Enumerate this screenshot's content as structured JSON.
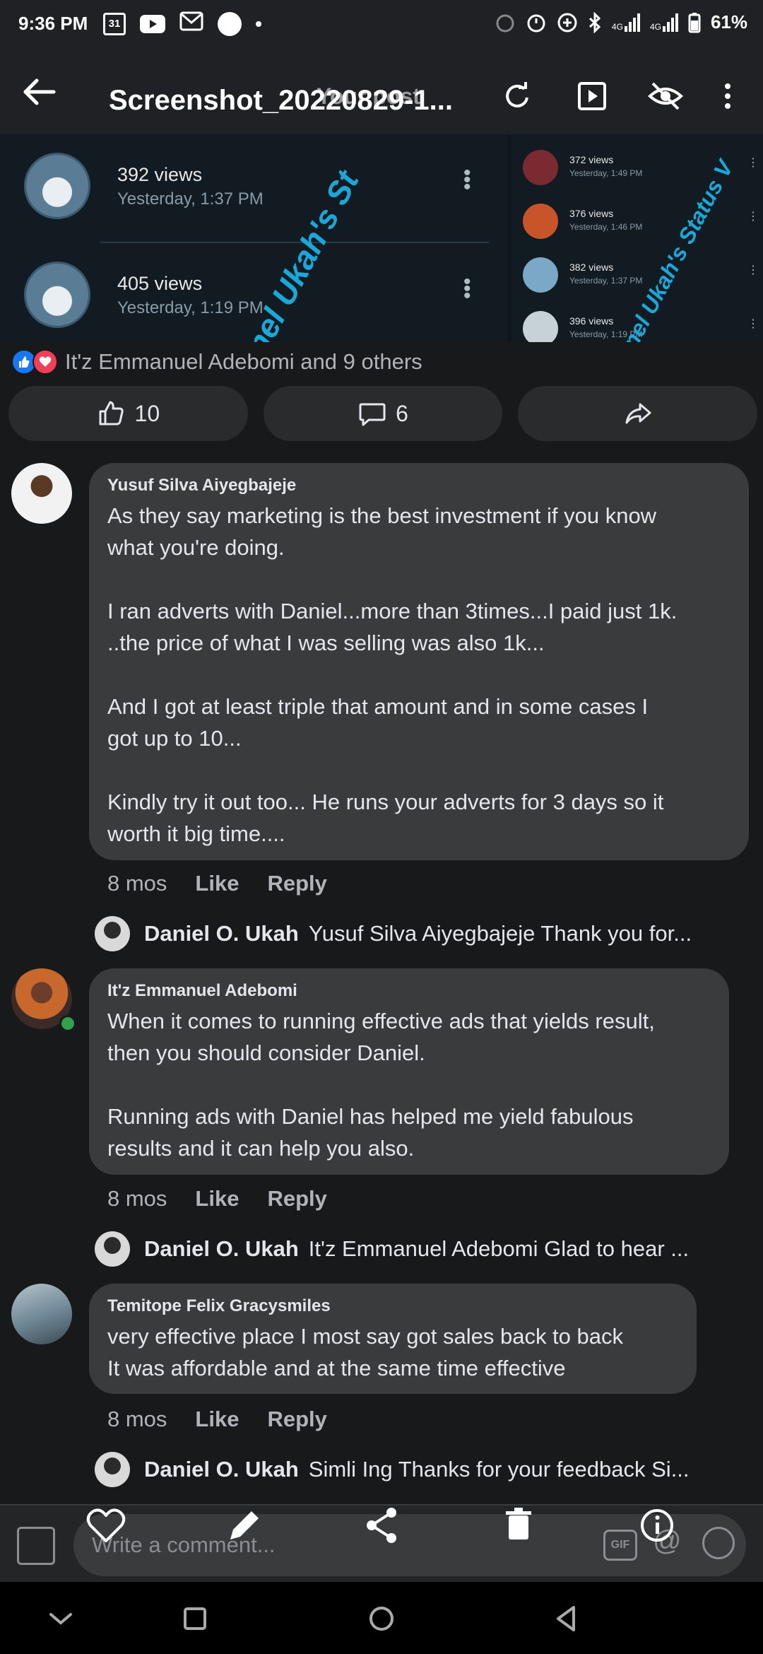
{
  "status_bar": {
    "time": "9:36 PM",
    "calendar_day": "31",
    "network_1": "4G",
    "network_2": "4G",
    "battery": "61%"
  },
  "viewer": {
    "title": "Screenshot_20220829-1...",
    "overlay_text": "Your post"
  },
  "shared_image": {
    "rows": [
      {
        "views": "392 views",
        "when": "Yesterday, 1:37 PM"
      },
      {
        "views": "405 views",
        "when": "Yesterday, 1:19 PM"
      }
    ],
    "mini_rows": [
      {
        "views": "372 views",
        "when": "Yesterday, 1:49 PM"
      },
      {
        "views": "376 views",
        "when": "Yesterday, 1:46 PM"
      },
      {
        "views": "382 views",
        "when": "Yesterday, 1:37 PM"
      },
      {
        "views": "396 views",
        "when": "Yesterday, 1:19 PM"
      }
    ],
    "watermark_left": "nel Ukah's St",
    "watermark_right": "nel Ukah's Status V"
  },
  "reactions": {
    "summary": "It'z Emmanuel Adebomi and 9 others"
  },
  "actions": {
    "like_count": "10",
    "comment_count": "6"
  },
  "comments": [
    {
      "author": "Yusuf Silva Aiyegbajeje",
      "body": "As they say marketing is the best investment if you know\nwhat you're doing.\n\nI ran adverts with Daniel...more than 3times...I paid just 1k.\n..the price of what I was selling was also 1k...\n\nAnd I got at least triple that amount and in some cases I\ngot up to 10...\n\nKindly try it out too... He runs your adverts for 3 days so it\nworth it big time....",
      "age": "8 mos",
      "like": "Like",
      "reply": "Reply",
      "reply_author": "Daniel O. Ukah",
      "reply_text": "Yusuf Silva Aiyegbajeje Thank you for..."
    },
    {
      "author": "It'z Emmanuel Adebomi",
      "body": "When it comes to running effective ads that yields result,\nthen you should consider Daniel.\n\nRunning ads with Daniel has helped me yield fabulous\nresults and it can help you also.",
      "age": "8 mos",
      "like": "Like",
      "reply": "Reply",
      "reply_author": "Daniel O. Ukah",
      "reply_text": "It'z Emmanuel Adebomi  Glad to hear ..."
    },
    {
      "author": "Temitope Felix Gracysmiles",
      "body": "very effective place I most say got sales back to back\nIt was affordable and at the same time effective",
      "age": "8 mos",
      "like": "Like",
      "reply": "Reply",
      "reply_author": "Daniel O. Ukah",
      "reply_text": "Simli Ing Thanks for your feedback Si..."
    }
  ],
  "composer": {
    "placeholder": "Write a comment...",
    "gif_label": "GIF"
  },
  "colors": {
    "background": "#18191a",
    "bubble": "#3a3b3c",
    "like_blue": "#1877f2",
    "love_red": "#f33e58",
    "online_green": "#31a24c",
    "watermark": "#19a8d8"
  }
}
